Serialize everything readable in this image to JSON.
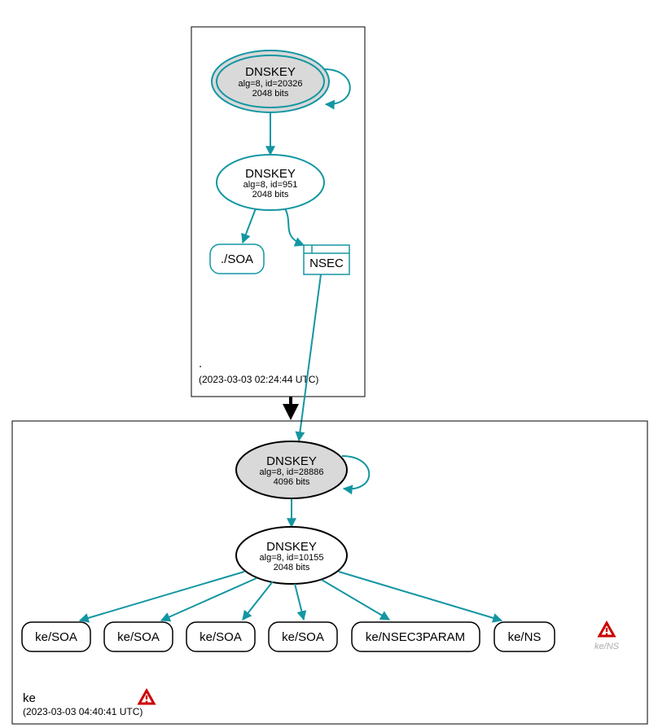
{
  "zones": {
    "root": {
      "label": ".",
      "timestamp": "(2023-03-03 02:24:44 UTC)",
      "ksk": {
        "title": "DNSKEY",
        "alg": "alg=8, id=20326",
        "bits": "2048 bits"
      },
      "zsk": {
        "title": "DNSKEY",
        "alg": "alg=8, id=951",
        "bits": "2048 bits"
      },
      "records": {
        "soa": "./SOA",
        "nsec": "NSEC"
      }
    },
    "ke": {
      "label": "ke",
      "timestamp": "(2023-03-03 04:40:41 UTC)",
      "ksk": {
        "title": "DNSKEY",
        "alg": "alg=8, id=28886",
        "bits": "4096 bits"
      },
      "zsk": {
        "title": "DNSKEY",
        "alg": "alg=8, id=10155",
        "bits": "2048 bits"
      },
      "records": {
        "soa1": "ke/SOA",
        "soa2": "ke/SOA",
        "soa3": "ke/SOA",
        "soa4": "ke/SOA",
        "nsec3param": "ke/NSEC3PARAM",
        "ns": "ke/NS",
        "ns_warn": "ke/NS"
      }
    }
  },
  "icons": {
    "warning_color": "#cc0000"
  }
}
